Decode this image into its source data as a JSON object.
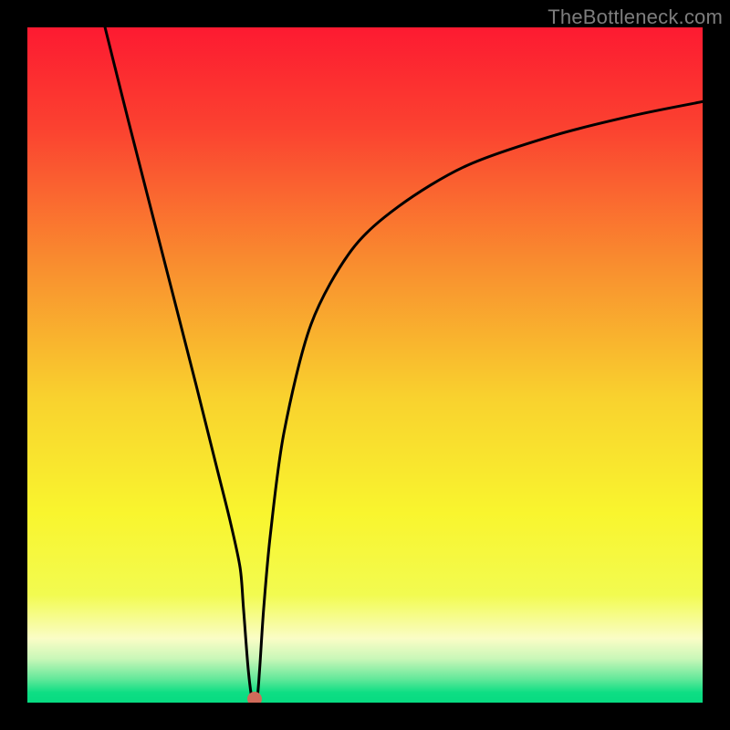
{
  "watermark": "TheBottleneck.com",
  "chart_data": {
    "type": "line",
    "title": "",
    "xlabel": "",
    "ylabel": "",
    "xlim": [
      0,
      100
    ],
    "ylim": [
      0,
      100
    ],
    "grid": false,
    "legend": false,
    "series": [
      {
        "name": "curve",
        "color": "#000000",
        "x": [
          11.5,
          15,
          20,
          25,
          28,
          30,
          31.5,
          32,
          32.7,
          33.3,
          34,
          34.4,
          35,
          36,
          38,
          42,
          48,
          55,
          65,
          78,
          90,
          100
        ],
        "y": [
          100,
          86,
          66.5,
          47,
          35,
          27,
          20,
          14,
          5,
          0.5,
          0.5,
          5,
          14,
          25,
          40,
          56,
          67,
          73.5,
          79.5,
          84,
          87,
          89
        ]
      }
    ],
    "marker": {
      "x": 33.6,
      "y": 0.5,
      "color": "#d06b5a"
    },
    "flat_region": {
      "x_start": 32.7,
      "x_end": 34,
      "y": 0.5
    },
    "gradient_stops": [
      {
        "pos": 0.0,
        "color": "#fd1a31"
      },
      {
        "pos": 0.15,
        "color": "#fb4230"
      },
      {
        "pos": 0.35,
        "color": "#f98d2f"
      },
      {
        "pos": 0.55,
        "color": "#f9d22e"
      },
      {
        "pos": 0.72,
        "color": "#f9f52e"
      },
      {
        "pos": 0.84,
        "color": "#f2fb50"
      },
      {
        "pos": 0.905,
        "color": "#fafdc6"
      },
      {
        "pos": 0.935,
        "color": "#c9f7b8"
      },
      {
        "pos": 0.965,
        "color": "#63e89a"
      },
      {
        "pos": 0.985,
        "color": "#0ede84"
      },
      {
        "pos": 1.0,
        "color": "#07db81"
      }
    ]
  }
}
